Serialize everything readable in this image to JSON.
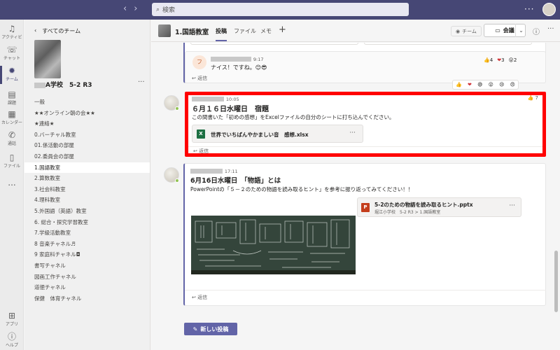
{
  "search": {
    "placeholder": "検索"
  },
  "rail": [
    {
      "label": "アクティビ",
      "icon": "bell-icon"
    },
    {
      "label": "チャット",
      "icon": "chat-icon"
    },
    {
      "label": "チーム",
      "icon": "teams-icon"
    },
    {
      "label": "課題",
      "icon": "assignments-icon"
    },
    {
      "label": "カレンダー",
      "icon": "calendar-icon"
    },
    {
      "label": "通話",
      "icon": "phone-icon"
    },
    {
      "label": "ファイル",
      "icon": "file-icon"
    },
    {
      "label": "...",
      "icon": "more-icon"
    },
    {
      "label": "アプリ",
      "icon": "apps-icon"
    },
    {
      "label": "ヘルプ",
      "icon": "help-icon"
    }
  ],
  "panel": {
    "back_label": "すべてのチーム",
    "team_name": "A学校　5-2 R3",
    "channels": [
      "一般",
      "★★オンライン朝の会★★",
      "★連絡★",
      "0.バーチャル教室",
      "01.係活動の部屋",
      "02.委員会の部屋",
      "1.国語教室",
      "2.算数教室",
      "3.社会科教室",
      "4.理科教室",
      "5.外国語（英語）教室",
      "6. 総合・探究学習教室",
      "7.学級活動教室",
      "8 音楽チャネル♬",
      "9 家庭科チャネル◘",
      "書写チャネル",
      "図画工作チャネル",
      "道徳チャネル",
      "保健　体育チャネル"
    ],
    "active_channel": "1.国語教室"
  },
  "header": {
    "title": "1.国語教室",
    "tabs": [
      "投稿",
      "ファイル",
      "メモ"
    ],
    "team_chip": "チーム",
    "meet_label": "会議"
  },
  "feed": {
    "msg1": {
      "time": "9:17",
      "text": "ナイス！ですね。",
      "emoji": "😊😎",
      "reactions": [
        {
          "emoji": "👍",
          "count": "4"
        },
        {
          "emoji": "❤",
          "count": "3"
        },
        {
          "emoji": "😮",
          "count": "2"
        }
      ],
      "reply": "返信"
    },
    "react_bar": [
      "👍",
      "❤",
      "😄",
      "😮",
      "😢",
      "😠"
    ],
    "msg2": {
      "time": "10:05",
      "title": "６月１６日水曜日　宿題",
      "body": "この間書いた「初めの感想」をExcelファイルの自分のシートに打ち込んでください。",
      "file": "世界でいちばんやかましい音　感想.xlsx",
      "like_count": "7",
      "reply": "返信"
    },
    "msg3": {
      "time": "17:11",
      "title": "6月16日水曜日　「物語」とは",
      "body": "PowerPointの「５－２のための物語を読み取るヒント」を参考に振り返ってみてください！！",
      "file_name": "5-2のための物語を読み取るヒント.pptx",
      "file_path": "堀江小学校　5-2 R3 > 1.国語教室",
      "reply": "返信"
    }
  },
  "new_post_label": "新しい投稿",
  "colors": {
    "topbar": "#464775",
    "brand": "#6264a7",
    "highlight": "#ff0000"
  }
}
